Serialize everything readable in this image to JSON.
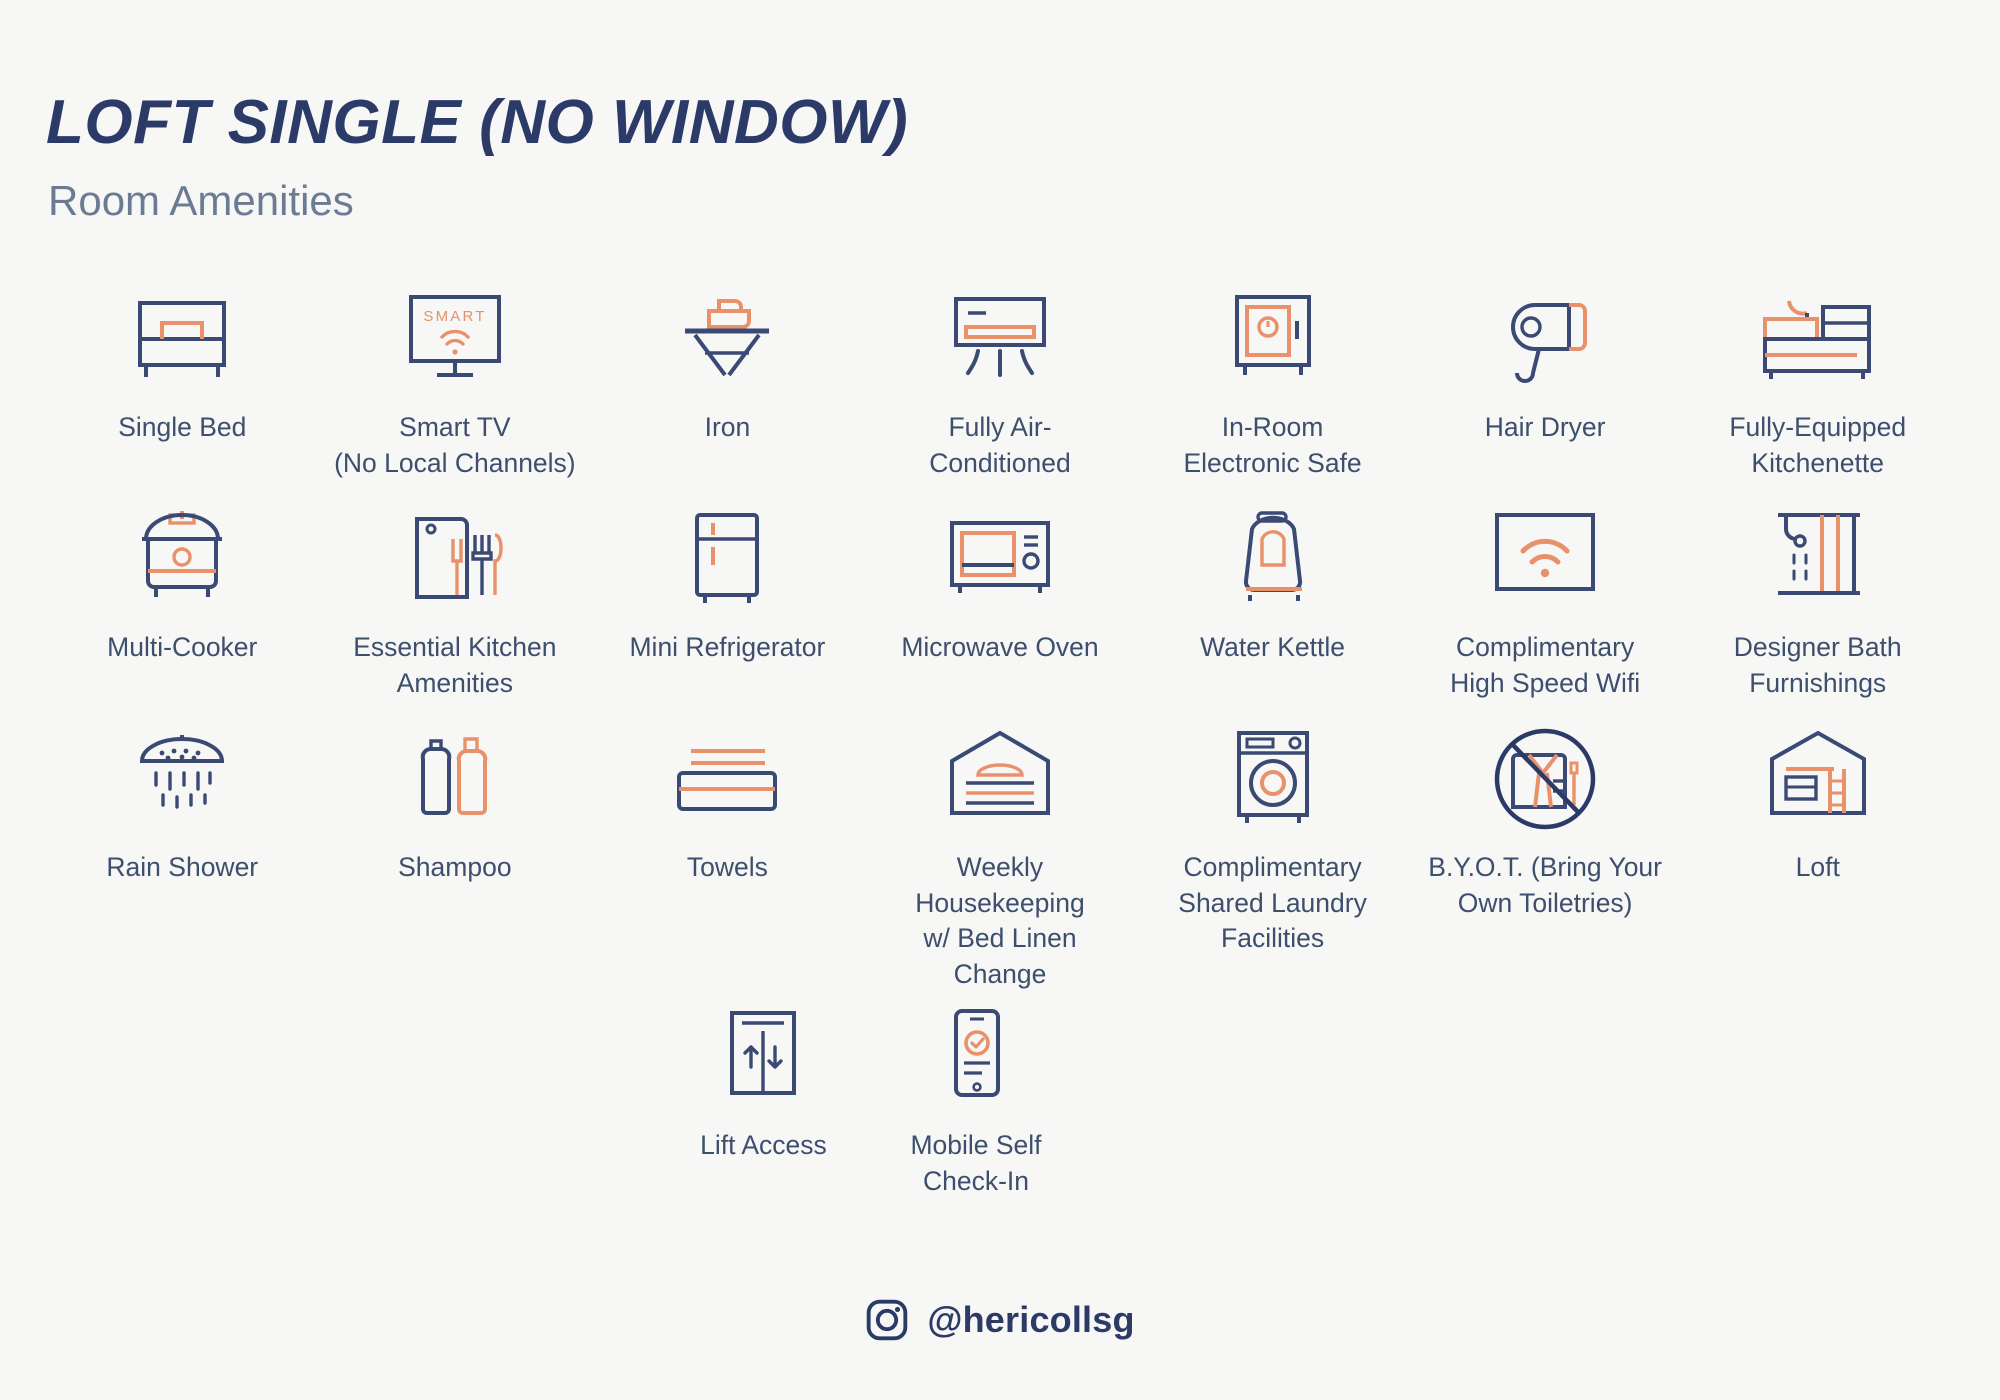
{
  "header": {
    "title": "LOFT SINGLE (NO WINDOW)",
    "subtitle": "Room Amenities"
  },
  "colors": {
    "background": "#f7f7f6",
    "navy": "#2b3a67",
    "outline": "#3a4a75",
    "text": "#3d4f6d",
    "subtitle": "#6b7b93",
    "accent_orange": "#e8916b"
  },
  "amenities": [
    {
      "icon": "single-bed-icon",
      "label": "Single Bed"
    },
    {
      "icon": "smart-tv-icon",
      "label": "Smart TV\n(No Local Channels)",
      "badge_text": "SMART"
    },
    {
      "icon": "iron-icon",
      "label": "Iron"
    },
    {
      "icon": "air-conditioner-icon",
      "label": "Fully Air-\nConditioned"
    },
    {
      "icon": "electronic-safe-icon",
      "label": "In-Room\nElectronic Safe"
    },
    {
      "icon": "hair-dryer-icon",
      "label": "Hair Dryer"
    },
    {
      "icon": "kitchenette-icon",
      "label": "Fully-Equipped\nKitchenette"
    },
    {
      "icon": "multi-cooker-icon",
      "label": "Multi-Cooker"
    },
    {
      "icon": "kitchen-utensils-icon",
      "label": "Essential Kitchen\nAmenities"
    },
    {
      "icon": "mini-refrigerator-icon",
      "label": "Mini Refrigerator"
    },
    {
      "icon": "microwave-oven-icon",
      "label": "Microwave Oven"
    },
    {
      "icon": "water-kettle-icon",
      "label": "Water Kettle"
    },
    {
      "icon": "wifi-icon",
      "label": "Complimentary\nHigh Speed Wifi"
    },
    {
      "icon": "bath-furnishings-icon",
      "label": "Designer Bath\nFurnishings"
    },
    {
      "icon": "rain-shower-icon",
      "label": "Rain Shower"
    },
    {
      "icon": "shampoo-bottles-icon",
      "label": "Shampoo"
    },
    {
      "icon": "towels-icon",
      "label": "Towels"
    },
    {
      "icon": "housekeeping-bed-icon",
      "label": "Weekly Housekeeping\nw/ Bed Linen Change"
    },
    {
      "icon": "washing-machine-icon",
      "label": "Complimentary\nShared Laundry\nFacilities"
    },
    {
      "icon": "no-toiletries-icon",
      "label": "B.Y.O.T. (Bring Your\nOwn Toiletries)"
    },
    {
      "icon": "loft-house-icon",
      "label": "Loft"
    },
    {
      "icon": "lift-access-icon",
      "label": "Lift Access"
    },
    {
      "icon": "mobile-check-in-icon",
      "label": "Mobile Self\nCheck-In"
    }
  ],
  "footer": {
    "icon": "instagram-icon",
    "handle": "@hericollsg"
  }
}
